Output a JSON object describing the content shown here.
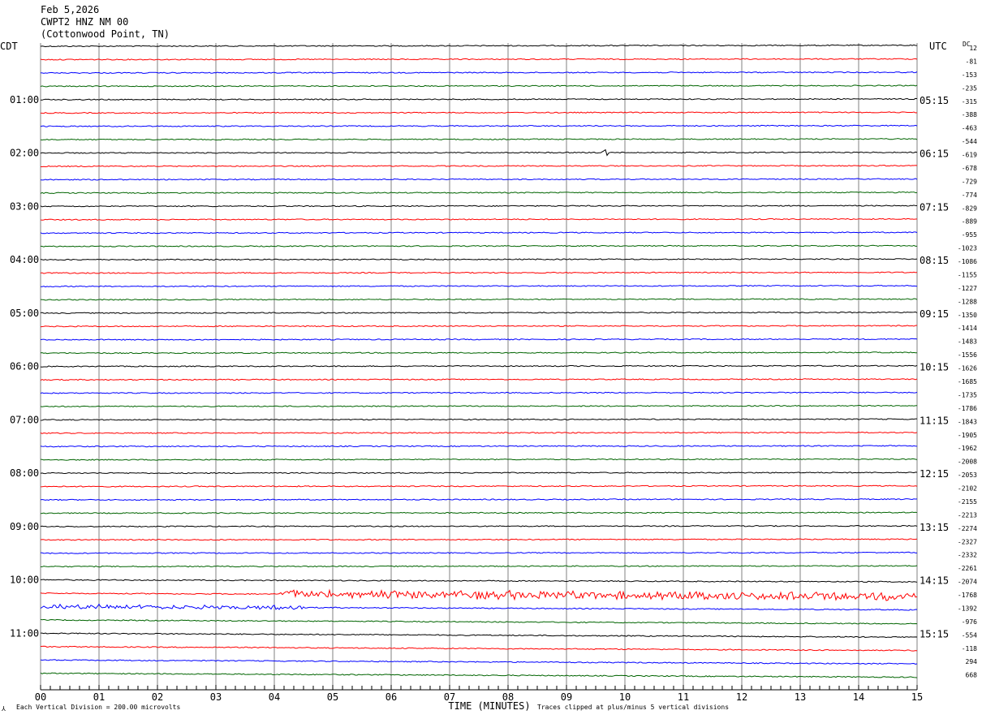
{
  "header": {
    "date": "Feb 5,2026",
    "station": "CWPT2 HNZ NM 00",
    "location": "(Cottonwood Point, TN)"
  },
  "left_axis_label": "CDT",
  "right_axis_label": "UTC",
  "dc_label": "DC",
  "footer": {
    "scale": "Each Vertical Division =  200.00 microvolts",
    "clip": "Traces clipped at plus/minus 5 vertical divisions"
  },
  "colors": {
    "trace_cycle": [
      "#000000",
      "#ff0000",
      "#0000ff",
      "#006400"
    ],
    "grid": "#808080"
  },
  "chart_data": {
    "type": "line",
    "xlabel": "TIME (MINUTES)",
    "xlim": [
      0,
      15
    ],
    "x_ticks": [
      "00",
      "01",
      "02",
      "03",
      "04",
      "05",
      "06",
      "07",
      "08",
      "09",
      "10",
      "11",
      "12",
      "13",
      "14",
      "15"
    ],
    "minutes_per_line": 15,
    "cdt_labels": [
      "01:00",
      "02:00",
      "03:00",
      "04:00",
      "05:00",
      "06:00",
      "07:00",
      "08:00",
      "09:00",
      "10:00",
      "11:00"
    ],
    "utc_labels": [
      "05:15",
      "06:15",
      "07:15",
      "08:15",
      "09:15",
      "10:15",
      "11:15",
      "12:15",
      "13:15",
      "14:15",
      "15:15"
    ],
    "dc_offsets": [
      "12",
      "-81",
      "-153",
      "-235",
      "-315",
      "-388",
      "-463",
      "-544",
      "-619",
      "-678",
      "-729",
      "-774",
      "-829",
      "-889",
      "-955",
      "-1023",
      "-1086",
      "-1155",
      "-1227",
      "-1288",
      "-1350",
      "-1414",
      "-1483",
      "-1556",
      "-1626",
      "-1685",
      "-1735",
      "-1786",
      "-1843",
      "-1905",
      "-1962",
      "-2008",
      "-2053",
      "-2102",
      "-2155",
      "-2213",
      "-2274",
      "-2327",
      "-2332",
      "-2261",
      "-2074",
      "-1768",
      "-1392",
      "-976",
      "-554",
      "-118",
      "294",
      "668"
    ],
    "drift_per_line_divisions": [
      0.15,
      0.1,
      0.1,
      0.1,
      0.1,
      0.1,
      0.1,
      0.1,
      0.1,
      0.1,
      0.1,
      0.1,
      0.1,
      0.1,
      0.1,
      0.1,
      0.1,
      0.1,
      0.1,
      0.1,
      0.1,
      0.1,
      0.1,
      0.1,
      0.1,
      0.1,
      0.1,
      0.1,
      0.1,
      0.1,
      0.1,
      0.1,
      0.1,
      0.1,
      0.1,
      0.1,
      0.1,
      0.1,
      0.1,
      0.1,
      -0.3,
      -0.5,
      -0.5,
      -0.6,
      -0.6,
      -0.6,
      -0.6,
      -0.6
    ],
    "events": [
      {
        "line": 8,
        "start_min": 9.6,
        "end_min": 9.7,
        "amplitude_divisions": 0.9
      },
      {
        "line": 41,
        "start_min": 4.1,
        "end_min": 15.0,
        "amplitude_divisions": 0.7
      },
      {
        "line": 42,
        "start_min": 0.0,
        "end_min": 4.5,
        "amplitude_divisions": 0.35
      }
    ]
  }
}
